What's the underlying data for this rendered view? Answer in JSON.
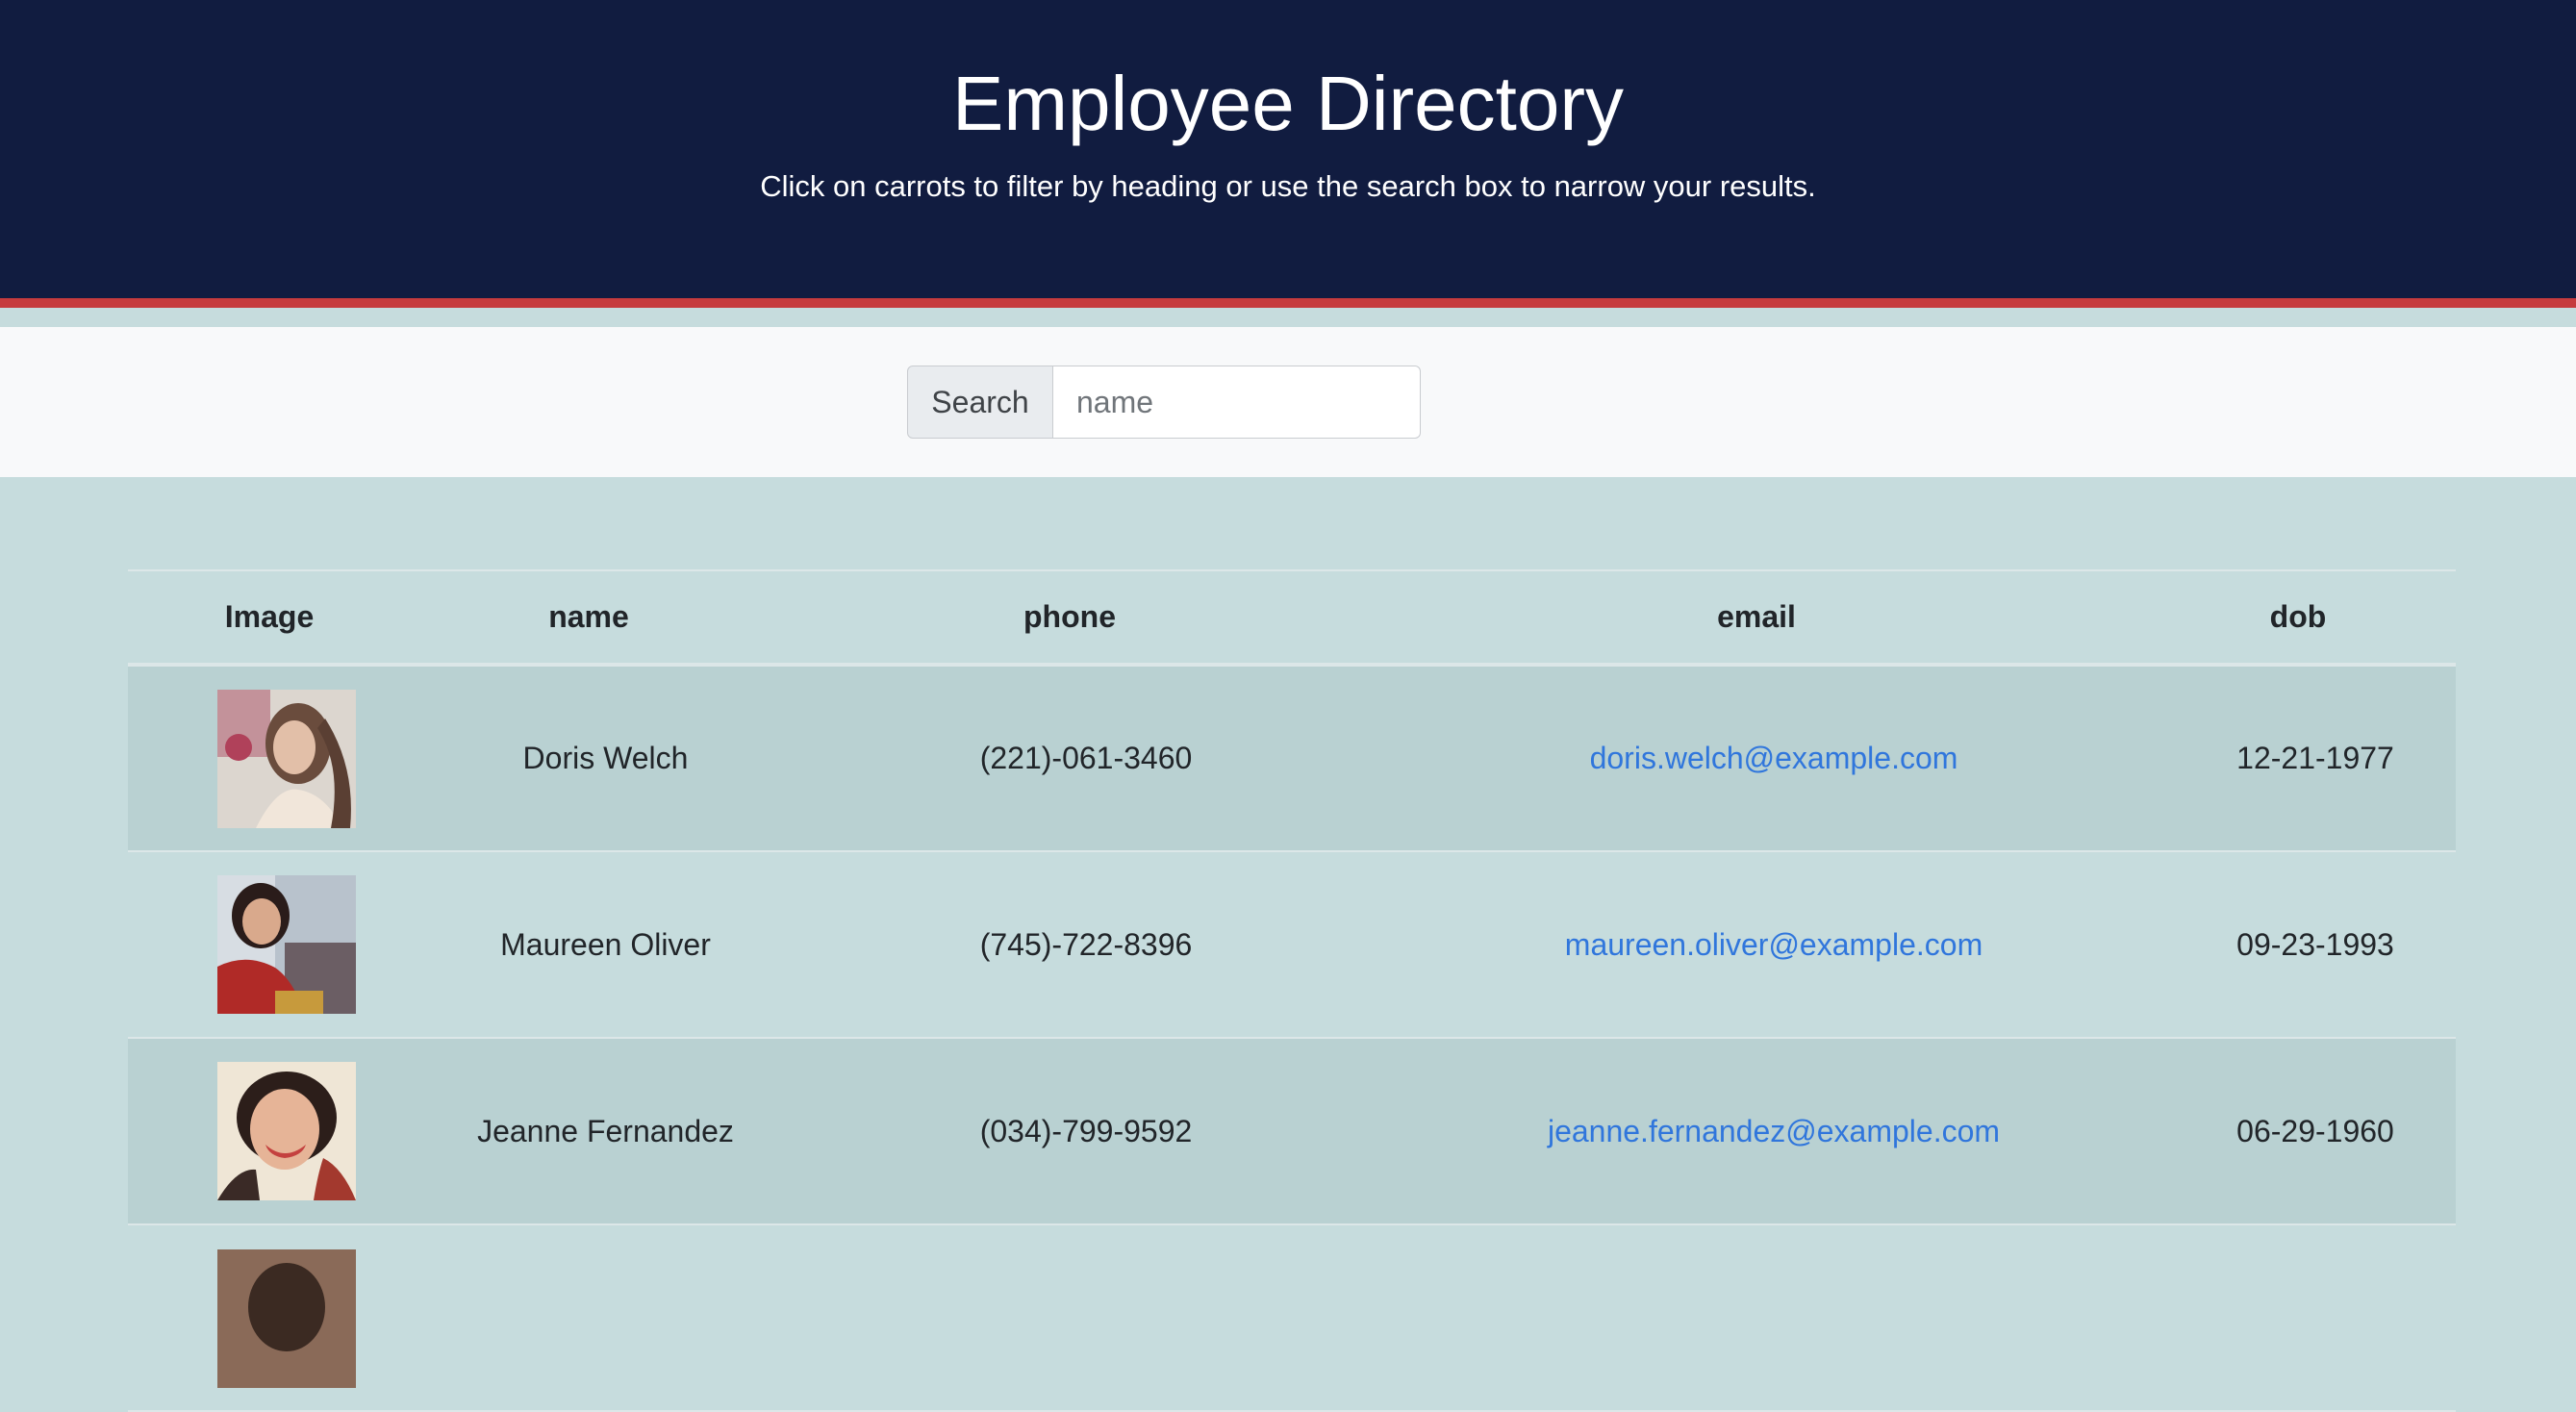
{
  "header": {
    "title": "Employee Directory",
    "subtitle": "Click on carrots to filter by heading or use the search box to narrow your results."
  },
  "search": {
    "label": "Search",
    "placeholder": "name",
    "value": ""
  },
  "table": {
    "columns": [
      "Image",
      "name",
      "phone",
      "email",
      "dob"
    ],
    "rows": [
      {
        "name": "Doris Welch",
        "phone": "(221)-061-3460",
        "email": "doris.welch@example.com",
        "dob": "12-21-1977"
      },
      {
        "name": "Maureen Oliver",
        "phone": "(745)-722-8396",
        "email": "maureen.oliver@example.com",
        "dob": "09-23-1993"
      },
      {
        "name": "Jeanne Fernandez",
        "phone": "(034)-799-9592",
        "email": "jeanne.fernandez@example.com",
        "dob": "06-29-1960"
      },
      {
        "name": "",
        "phone": "",
        "email": "",
        "dob": ""
      }
    ]
  },
  "colors": {
    "header_bg": "#111c40",
    "accent_stripe": "#c63b3d",
    "link": "#3076dc",
    "page_bg": "#c6dcdd",
    "row_alt_bg": "#b9d1d2"
  }
}
